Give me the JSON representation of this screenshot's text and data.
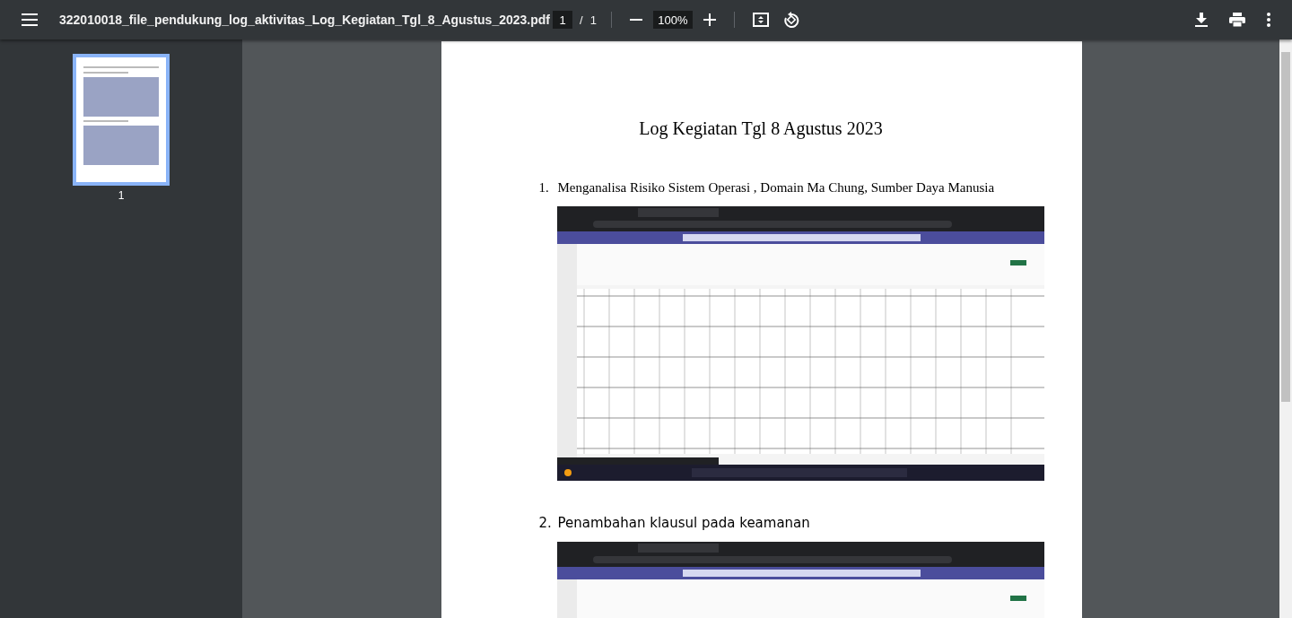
{
  "toolbar": {
    "file_name": "322010018_file_pendukung_log_aktivitas_Log_Kegiatan_Tgl_8_Agustus_2023.pdf",
    "page_value": "1",
    "page_separator": "/",
    "page_count": "1",
    "zoom": "100%"
  },
  "sidebar": {
    "thumbnails": [
      {
        "label": "1",
        "selected": true
      }
    ]
  },
  "document": {
    "title": "Log Kegiatan Tgl 8 Agustus 2023",
    "items": [
      {
        "number": "1.",
        "text": "Menganalisa Risiko Sistem Operasi , Domain Ma Chung, Sumber Daya Manusia",
        "kind": "serif"
      },
      {
        "number": "2.",
        "text": "Penambahan klausul pada keamanan",
        "kind": "sans"
      }
    ]
  }
}
